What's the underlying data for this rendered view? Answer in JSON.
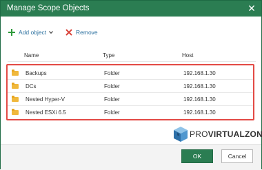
{
  "dialog": {
    "title": "Manage Scope Objects",
    "close_glyph": "✕"
  },
  "toolbar": {
    "add_label": "Add object",
    "remove_label": "Remove"
  },
  "table": {
    "columns": {
      "name": "Name",
      "type": "Type",
      "host": "Host"
    },
    "rows": [
      {
        "name": "Backups",
        "type": "Folder",
        "host": "192.168.1.30"
      },
      {
        "name": "DCs",
        "type": "Folder",
        "host": "192.168.1.30"
      },
      {
        "name": "Nested Hyper-V",
        "type": "Folder",
        "host": "192.168.1.30"
      },
      {
        "name": "Nested ESXi 6.5",
        "type": "Folder",
        "host": "192.168.1.30"
      }
    ]
  },
  "watermark": {
    "part1": "PRO",
    "part2": "VIRTUALZONE"
  },
  "footer": {
    "ok_label": "OK",
    "cancel_label": "Cancel"
  },
  "colors": {
    "accent": "#2b7d52",
    "highlight_border": "#e34a45",
    "link": "#2a6f9e",
    "folder": "#f0b83c"
  },
  "icons": {
    "add": "plus-icon",
    "remove": "x-icon",
    "row": "folder-icon",
    "close": "close-icon",
    "dropdown": "chevron-down-icon"
  }
}
